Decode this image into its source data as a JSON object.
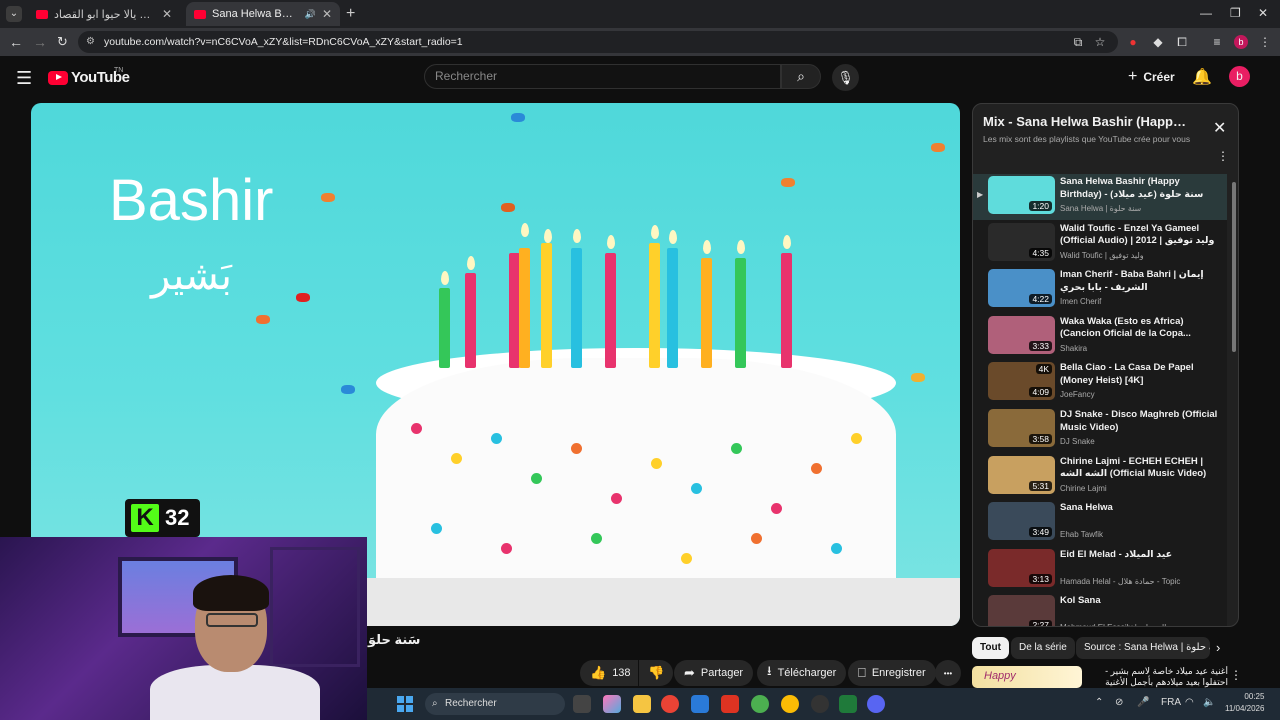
{
  "browser": {
    "tabs": [
      {
        "title": "يلا حالا يالا حيوا ابو القصاد uTube"
      },
      {
        "title": "Sana Helwa Bashir (Happy B"
      }
    ],
    "url": "youtube.com/watch?v=nC6CVoA_xZY&list=RDnC6CVoA_xZY&start_radio=1"
  },
  "youtube": {
    "logo_text": "YouTube",
    "logo_sup": "TN",
    "search_placeholder": "Rechercher",
    "create_label": "Créer",
    "avatar_letter": "b"
  },
  "video": {
    "overlay_name_latin": "Bashir",
    "overlay_name_arabic": "بَشير",
    "title": "سَنة حلوَ",
    "likes": "138",
    "share_label": "Partager",
    "download_label": "Télécharger",
    "save_label": "Enregistrer",
    "more": "•••"
  },
  "stream_overlay": {
    "count": "32"
  },
  "playlist": {
    "title": "Mix - Sana Helwa Bashir (Happy Birthday)",
    "subtitle": "Les mix sont des playlists que YouTube crée pour vous",
    "items": [
      {
        "title": "Sana Helwa Bashir (Happy Birthday) - (عيد ميلاد) سنة حلوة بشير",
        "channel": "Sana Helwa | سنة حلوة",
        "duration": "1:20",
        "thumb": "#5fdcdc",
        "active": true
      },
      {
        "title": "Walid Toufic - Enzel Ya Gameel (Official Audio) | 2012 | وليد توفيق",
        "channel": "Walid Toufic | وليد توفيق",
        "duration": "4:35",
        "thumb": "#2a2a2a"
      },
      {
        "title": "Iman Cherif - Baba Bahri | إيمان الشريف - بابا بحري",
        "channel": "Imen Cherif",
        "duration": "4:22",
        "thumb": "#4a90c8"
      },
      {
        "title": "Waka Waka (Esto es Africa) (Cancion Oficial de la Copa...",
        "channel": "Shakira",
        "duration": "3:33",
        "thumb": "#b0607a"
      },
      {
        "title": "Bella Ciao - La Casa De Papel (Money Heist) [4K]",
        "channel": "JoeFancy",
        "duration": "4:09",
        "thumb": "#6a4a2a",
        "badge": "4K"
      },
      {
        "title": "DJ Snake - Disco Maghreb (Official Music Video)",
        "channel": "DJ Snake",
        "duration": "3:58",
        "thumb": "#8a6a3a"
      },
      {
        "title": "Chirine Lajmi - ECHEH ECHEH | الشه الشه (Official Music Video)",
        "channel": "Chirine Lajmi",
        "duration": "5:31",
        "thumb": "#c8a060"
      },
      {
        "title": "Sana Helwa",
        "channel": "Ehab Tawfik",
        "duration": "3:49",
        "thumb": "#3a4a5a"
      },
      {
        "title": "Eid El Melad - عيد الميلاد",
        "channel": "Hamada Helal - حمادة هلال - Topic",
        "duration": "3:13",
        "thumb": "#7a2a2a"
      },
      {
        "title": "Kol Sana",
        "channel": "Mahmoud El Esseily | محمود العسيلي",
        "duration": "2:27",
        "thumb": "#5a3a3a"
      }
    ]
  },
  "chips": [
    "Tout",
    "De la série",
    "Source : Sana Helwa | سنة حلوة"
  ],
  "next_video": {
    "thumb_text": "Happy",
    "title": "أغنية عيد ميلاد خاصة لاسم بشير - احتفلوا بعيد ميلادهم بأجمل الأغنية"
  },
  "taskbar": {
    "search_label": "Rechercher",
    "language": "FRA",
    "time": "00:25",
    "date": "11/04/2026"
  }
}
